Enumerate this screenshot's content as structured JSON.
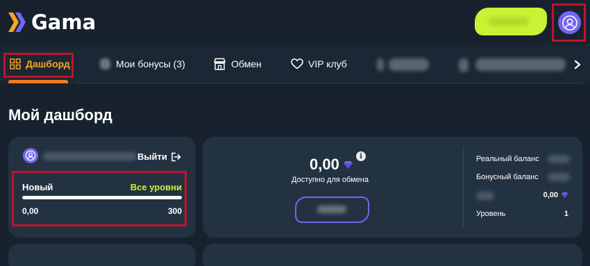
{
  "header": {
    "brand": "Gama",
    "deposit_button_label_hidden": true
  },
  "tabs": [
    {
      "label": "Дашборд",
      "icon": "dashboard-grid-icon",
      "active": true
    },
    {
      "label": "Мои бонусы (3)",
      "icon": "bonus-icon"
    },
    {
      "label": "Обмен",
      "icon": "shop-icon"
    },
    {
      "label": "VIP клуб",
      "icon": "heart-icon"
    }
  ],
  "page": {
    "title": "Мой дашборд"
  },
  "user_card": {
    "logout_label": "Выйти",
    "level": {
      "name": "Новый",
      "all_levels_label": "Все уровни",
      "min": "0,00",
      "max": "300",
      "progress": 0
    }
  },
  "exchange_card": {
    "available_value": "0,00",
    "available_label": "Доступно для обмена",
    "info_symbol": "i"
  },
  "balances": {
    "real_label": "Реальный баланс",
    "bonus_label": "Бонусный баланс",
    "coin_value": "0,00",
    "level_label": "Уровень",
    "level_value": "1"
  },
  "colors": {
    "background": "#17222e",
    "card": "#233241",
    "accent_lime": "#c9f235",
    "accent_purple": "#7466f0",
    "accent_orange": "#f6a623",
    "highlight_red": "#c1132d"
  }
}
